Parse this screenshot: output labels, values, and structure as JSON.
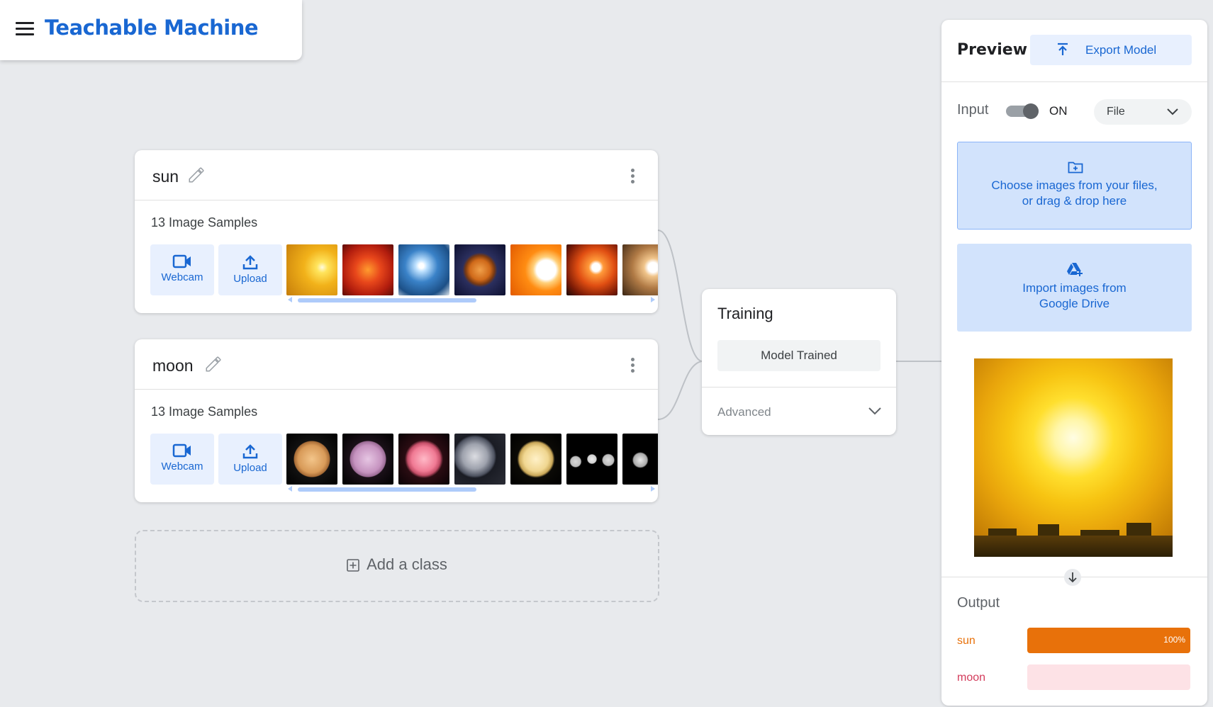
{
  "header": {
    "app_title": "Teachable Machine"
  },
  "classes": [
    {
      "name": "sun",
      "samples_label": "13 Image Samples",
      "webcam_label": "Webcam",
      "upload_label": "Upload"
    },
    {
      "name": "moon",
      "samples_label": "13 Image Samples",
      "webcam_label": "Webcam",
      "upload_label": "Upload"
    }
  ],
  "add_class_label": "Add a class",
  "training": {
    "title": "Training",
    "status_button": "Model Trained",
    "advanced_label": "Advanced"
  },
  "preview": {
    "title": "Preview",
    "export_label": "Export Model",
    "input_label": "Input",
    "toggle_state": "ON",
    "input_source": "File",
    "drop_text_line1": "Choose images from your files,",
    "drop_text_line2": "or drag & drop here",
    "drive_text_line1": "Import images from",
    "drive_text_line2": "Google Drive",
    "output_label": "Output",
    "outputs": [
      {
        "name": "sun",
        "value": 1.0,
        "percent_label": "100%",
        "color": "#e8710a",
        "bg": "#fde3cf"
      },
      {
        "name": "moon",
        "value": 0.0,
        "percent_label": "",
        "color": "#d33b5b",
        "bg": "#fde2e6"
      }
    ]
  },
  "icons": [
    "menu-icon",
    "edit-icon",
    "more-vert-icon",
    "webcam-icon",
    "upload-icon",
    "add-box-icon",
    "chevron-down-icon",
    "export-icon",
    "folder-icon",
    "google-drive-icon",
    "arrow-down-icon"
  ]
}
